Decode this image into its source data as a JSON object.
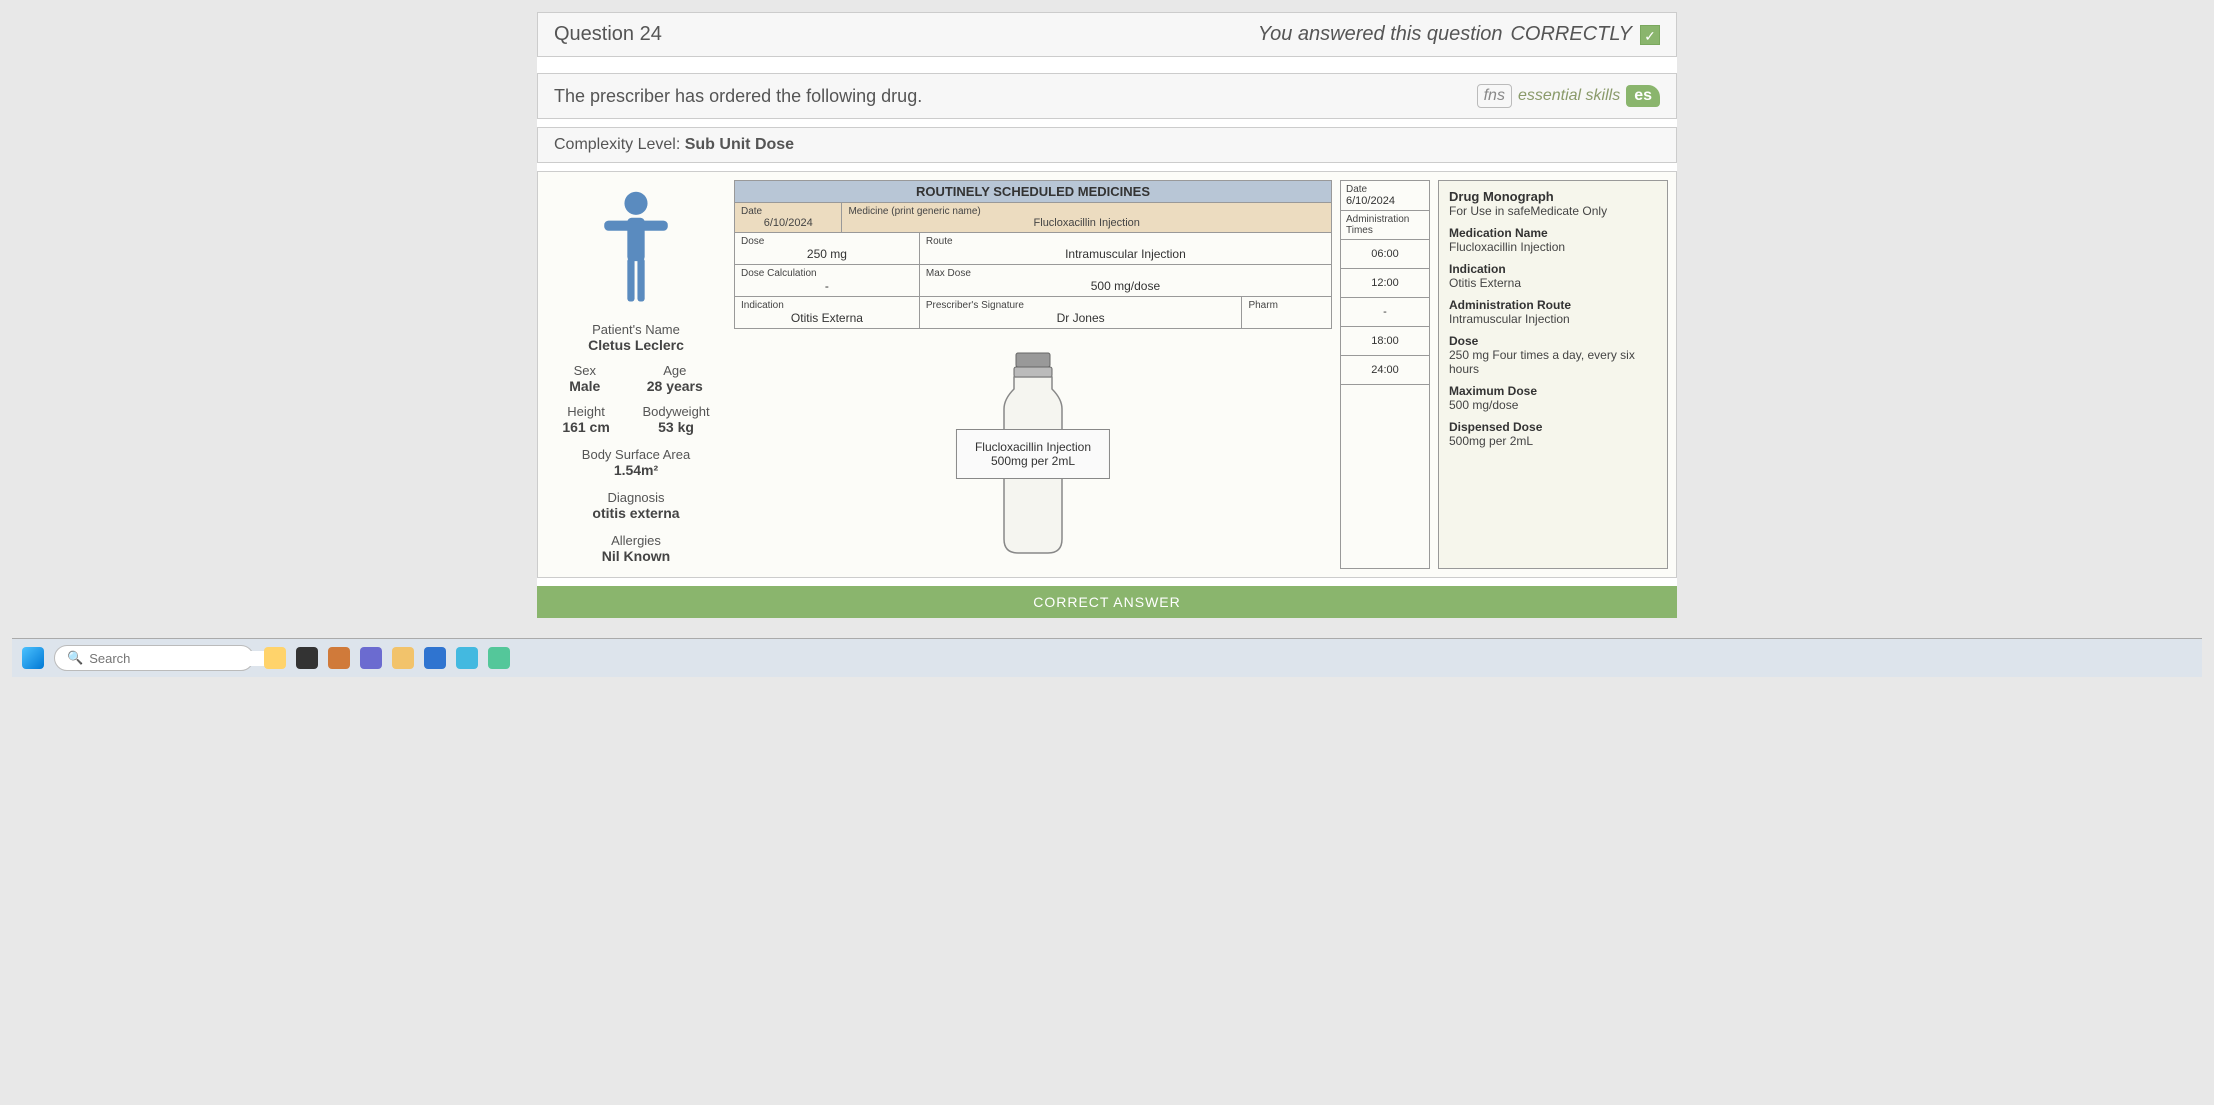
{
  "header": {
    "question_label": "Question 24",
    "answer_status_prefix": "You answered this question",
    "answer_status_word": "CORRECTLY",
    "check_icon": "✓"
  },
  "question": {
    "text": "The prescriber has ordered the following drug.",
    "logo_fns": "fns",
    "logo_text": "essential skills",
    "logo_es": "es"
  },
  "complexity": {
    "label": "Complexity Level:",
    "value": "Sub Unit Dose"
  },
  "patient": {
    "name_label": "Patient's Name",
    "name_value": "Cletus Leclerc",
    "sex_label": "Sex",
    "sex_value": "Male",
    "age_label": "Age",
    "age_value": "28 years",
    "height_label": "Height",
    "height_value": "161 cm",
    "weight_label": "Bodyweight",
    "weight_value": "53 kg",
    "bsa_label": "Body Surface Area",
    "bsa_value": "1.54m²",
    "diagnosis_label": "Diagnosis",
    "diagnosis_value": "otitis externa",
    "allergies_label": "Allergies",
    "allergies_value": "Nil Known"
  },
  "chart": {
    "title": "ROUTINELY SCHEDULED MEDICINES",
    "date_label": "Date",
    "date_value": "6/10/2024",
    "medicine_label": "Medicine (print generic name)",
    "medicine_value": "Flucloxacillin Injection",
    "dose_label": "Dose",
    "dose_value": "250 mg",
    "route_label": "Route",
    "route_value": "Intramuscular Injection",
    "dosecalc_label": "Dose Calculation",
    "dosecalc_value": "-",
    "maxdose_label": "Max Dose",
    "maxdose_value": "500 mg/dose",
    "indication_label": "Indication",
    "indication_value": "Otitis Externa",
    "sig_label": "Prescriber's Signature",
    "sig_value": "Dr Jones",
    "pharm_label": "Pharm"
  },
  "admin": {
    "date_label": "Date",
    "date_value": "6/10/2024",
    "times_label": "Administration Times",
    "t1": "06:00",
    "t2": "12:00",
    "t3": "-",
    "t4": "18:00",
    "t5": "24:00"
  },
  "monograph": {
    "title": "Drug Monograph",
    "subtitle": "For Use in safeMedicate Only",
    "medname_h": "Medication Name",
    "medname_v": "Flucloxacillin Injection",
    "ind_h": "Indication",
    "ind_v": "Otitis Externa",
    "route_h": "Administration Route",
    "route_v": "Intramuscular Injection",
    "dose_h": "Dose",
    "dose_v": "250 mg Four times a day, every six hours",
    "max_h": "Maximum Dose",
    "max_v": "500 mg/dose",
    "disp_h": "Dispensed Dose",
    "disp_v": "500mg per 2mL"
  },
  "vial": {
    "line1": "Flucloxacillin Injection",
    "line2": "500mg per 2mL"
  },
  "correct_bar": "CORRECT ANSWER",
  "taskbar": {
    "search_placeholder": "Search"
  }
}
